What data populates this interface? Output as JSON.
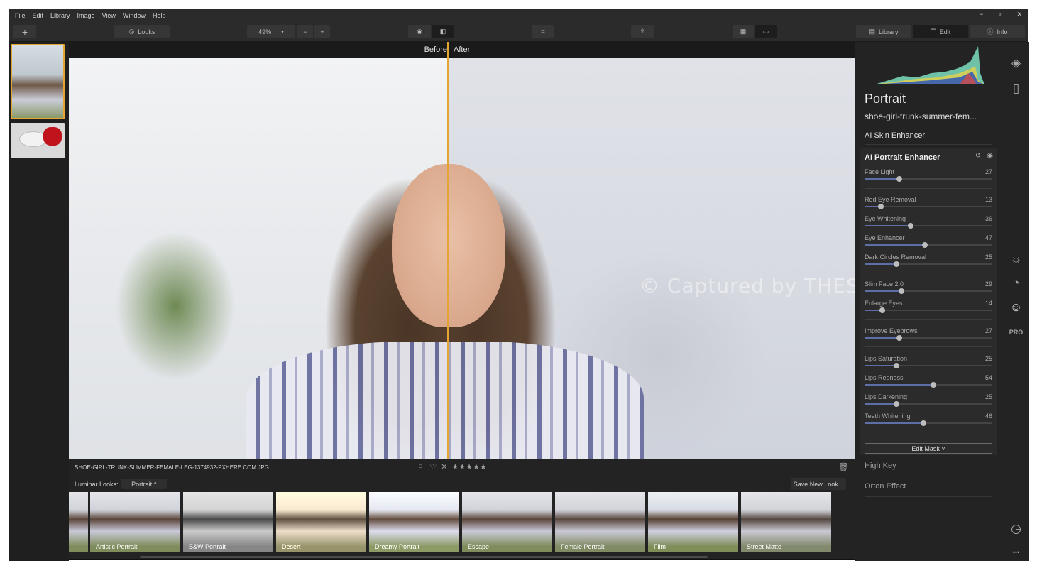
{
  "menu": [
    "File",
    "Edit",
    "Library",
    "Image",
    "View",
    "Window",
    "Help"
  ],
  "window_controls": [
    "−",
    "▫",
    "✕"
  ],
  "toolbar": {
    "add_label": "+",
    "looks_label": "Looks",
    "zoom_value": "49%",
    "zoom_minus": "−",
    "zoom_plus": "+",
    "tab_library": "Library",
    "tab_edit": "Edit",
    "tab_info": "Info"
  },
  "compare": {
    "before_label": "Before",
    "after_label": "After"
  },
  "watermark": "© Captured by THESOFTWARE.SHOP",
  "info_bar": {
    "filename": "SHOE-GIRL-TRUNK-SUMMER-FEMALE-LEG-1374932-PXHERE.COM.JPG",
    "stars": "★★★★★"
  },
  "looks_bar": {
    "label": "Luminar Looks:",
    "category": "Portrait ^",
    "save_label": "Save New Look..."
  },
  "looks": [
    "Artistic Portrait",
    "B&W Portrait",
    "Desert",
    "Dreamy Portrait",
    "Escape",
    "Female Portrait",
    "Film",
    "Street Matte"
  ],
  "panel": {
    "title": "Portrait",
    "filename": "shoe-girl-trunk-summer-fem...",
    "section_skin": "AI Skin Enhancer",
    "tool_title": "AI Portrait Enhancer",
    "sliders": [
      {
        "name": "Face Light",
        "value": 27
      },
      {
        "name": "Red Eye Removal",
        "value": 13
      },
      {
        "name": "Eye Whitening",
        "value": 36
      },
      {
        "name": "Eye Enhancer",
        "value": 47
      },
      {
        "name": "Dark Circles Removal",
        "value": 25
      },
      {
        "name": "Slim Face 2.0",
        "value": 29
      },
      {
        "name": "Enlarge Eyes",
        "value": 14
      },
      {
        "name": "Improve Eyebrows",
        "value": 27
      },
      {
        "name": "Lips Saturation",
        "value": 25
      },
      {
        "name": "Lips Redness",
        "value": 54
      },
      {
        "name": "Lips Darkening",
        "value": 25
      },
      {
        "name": "Teeth Whitening",
        "value": 46
      }
    ],
    "mask_button": "Edit Mask ˅",
    "section_highkey": "High Key",
    "section_orton": "Orton Effect"
  },
  "side_icons": {
    "pro_label": "PRO",
    "more": "•••"
  },
  "colors": {
    "accent": "#e5a631",
    "slider_fill": "#5d6fa6"
  }
}
